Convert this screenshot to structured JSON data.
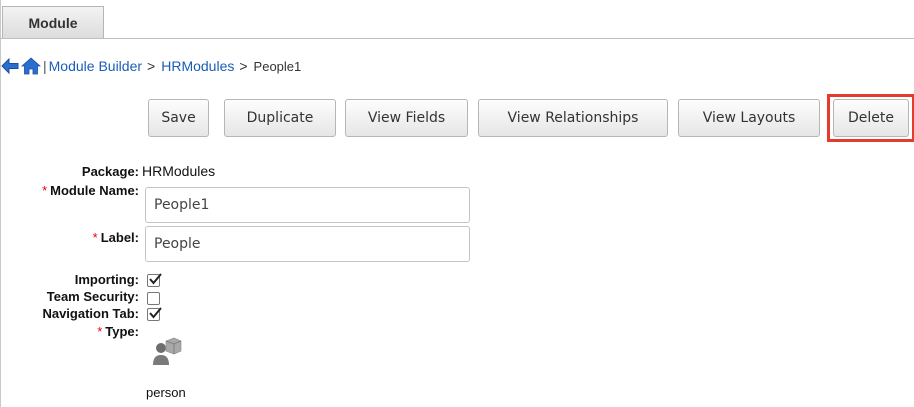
{
  "tabs": [
    {
      "label": "Module"
    }
  ],
  "breadcrumb": {
    "separator": "|",
    "items": [
      {
        "label": "Module Builder",
        "link": true
      },
      {
        "label": "HRModules",
        "link": true
      },
      {
        "label": "People1",
        "link": false
      }
    ],
    "arrow": ">"
  },
  "toolbar": {
    "save": "Save",
    "duplicate": "Duplicate",
    "view_fields": "View Fields",
    "view_relationships": "View Relationships",
    "view_layouts": "View Layouts",
    "delete": "Delete"
  },
  "form": {
    "required_marker": "*",
    "package": {
      "label": "Package:",
      "value": "HRModules"
    },
    "module_name": {
      "label": "Module Name:",
      "value": "People1"
    },
    "module_label": {
      "label": "Label:",
      "value": "People"
    },
    "importing": {
      "label": "Importing:",
      "checked": true
    },
    "team_security": {
      "label": "Team Security:",
      "checked": false
    },
    "navigation_tab": {
      "label": "Navigation Tab:",
      "checked": true
    },
    "type": {
      "label": "Type:",
      "value": "person",
      "icon": "person-type-icon"
    }
  },
  "colors": {
    "link": "#1a5db5",
    "required": "#e00000",
    "highlight": "#e53b2c"
  }
}
